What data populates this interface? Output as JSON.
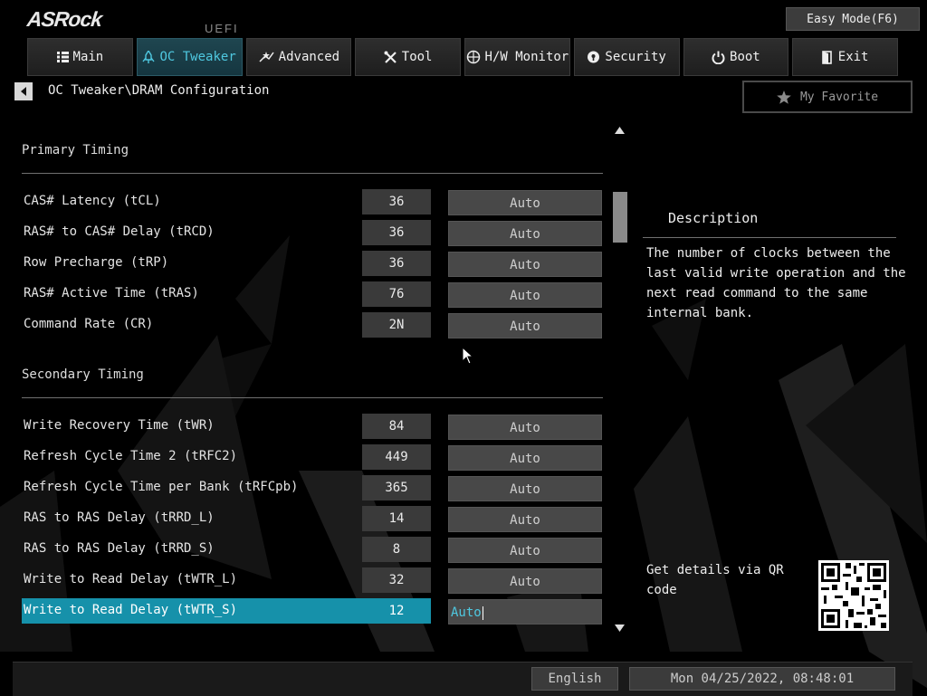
{
  "header": {
    "logo": "ASRock",
    "uefi": "UEFI",
    "easy_mode": "Easy Mode(F6)"
  },
  "tabs": [
    {
      "label": "Main",
      "icon": "list-icon"
    },
    {
      "label": "OC Tweaker",
      "icon": "rocket-icon",
      "active": true
    },
    {
      "label": "Advanced",
      "icon": "star-icon"
    },
    {
      "label": "Tool",
      "icon": "tools-icon"
    },
    {
      "label": "H/W Monitor",
      "icon": "monitor-icon"
    },
    {
      "label": "Security",
      "icon": "shield-icon"
    },
    {
      "label": "Boot",
      "icon": "power-icon"
    },
    {
      "label": "Exit",
      "icon": "exit-icon"
    }
  ],
  "breadcrumb": "OC Tweaker\\DRAM Configuration",
  "favorite": "My Favorite",
  "sections": {
    "primary": "Primary Timing",
    "secondary": "Secondary Timing"
  },
  "primary_rows": [
    {
      "label": "CAS# Latency (tCL)",
      "value": "36",
      "setting": "Auto"
    },
    {
      "label": "RAS# to CAS# Delay (tRCD)",
      "value": "36",
      "setting": "Auto"
    },
    {
      "label": "Row Precharge (tRP)",
      "value": "36",
      "setting": "Auto"
    },
    {
      "label": "RAS# Active Time (tRAS)",
      "value": "76",
      "setting": "Auto"
    },
    {
      "label": "Command Rate (CR)",
      "value": "2N",
      "setting": "Auto"
    }
  ],
  "secondary_rows": [
    {
      "label": "Write Recovery Time (tWR)",
      "value": "84",
      "setting": "Auto"
    },
    {
      "label": "Refresh Cycle Time 2 (tRFC2)",
      "value": "449",
      "setting": "Auto"
    },
    {
      "label": "Refresh Cycle Time per Bank (tRFCpb)",
      "value": "365",
      "setting": "Auto"
    },
    {
      "label": "RAS to RAS Delay (tRRD_L)",
      "value": "14",
      "setting": "Auto"
    },
    {
      "label": "RAS to RAS Delay (tRRD_S)",
      "value": "8",
      "setting": "Auto"
    },
    {
      "label": "Write to Read Delay (tWTR_L)",
      "value": "32",
      "setting": "Auto"
    },
    {
      "label": "Write to Read Delay (tWTR_S)",
      "value": "12",
      "setting": "Auto",
      "selected": true
    }
  ],
  "description": {
    "title": "Description",
    "text": "The number of clocks between the last valid write operation and the next read command to the same internal bank.",
    "qr_label": "Get details via QR code"
  },
  "footer": {
    "language": "English",
    "datetime": "Mon 04/25/2022, 08:48:01"
  },
  "colors": {
    "accent": "#4fc8e0",
    "selection": "#1691aa",
    "background": "#000000"
  }
}
